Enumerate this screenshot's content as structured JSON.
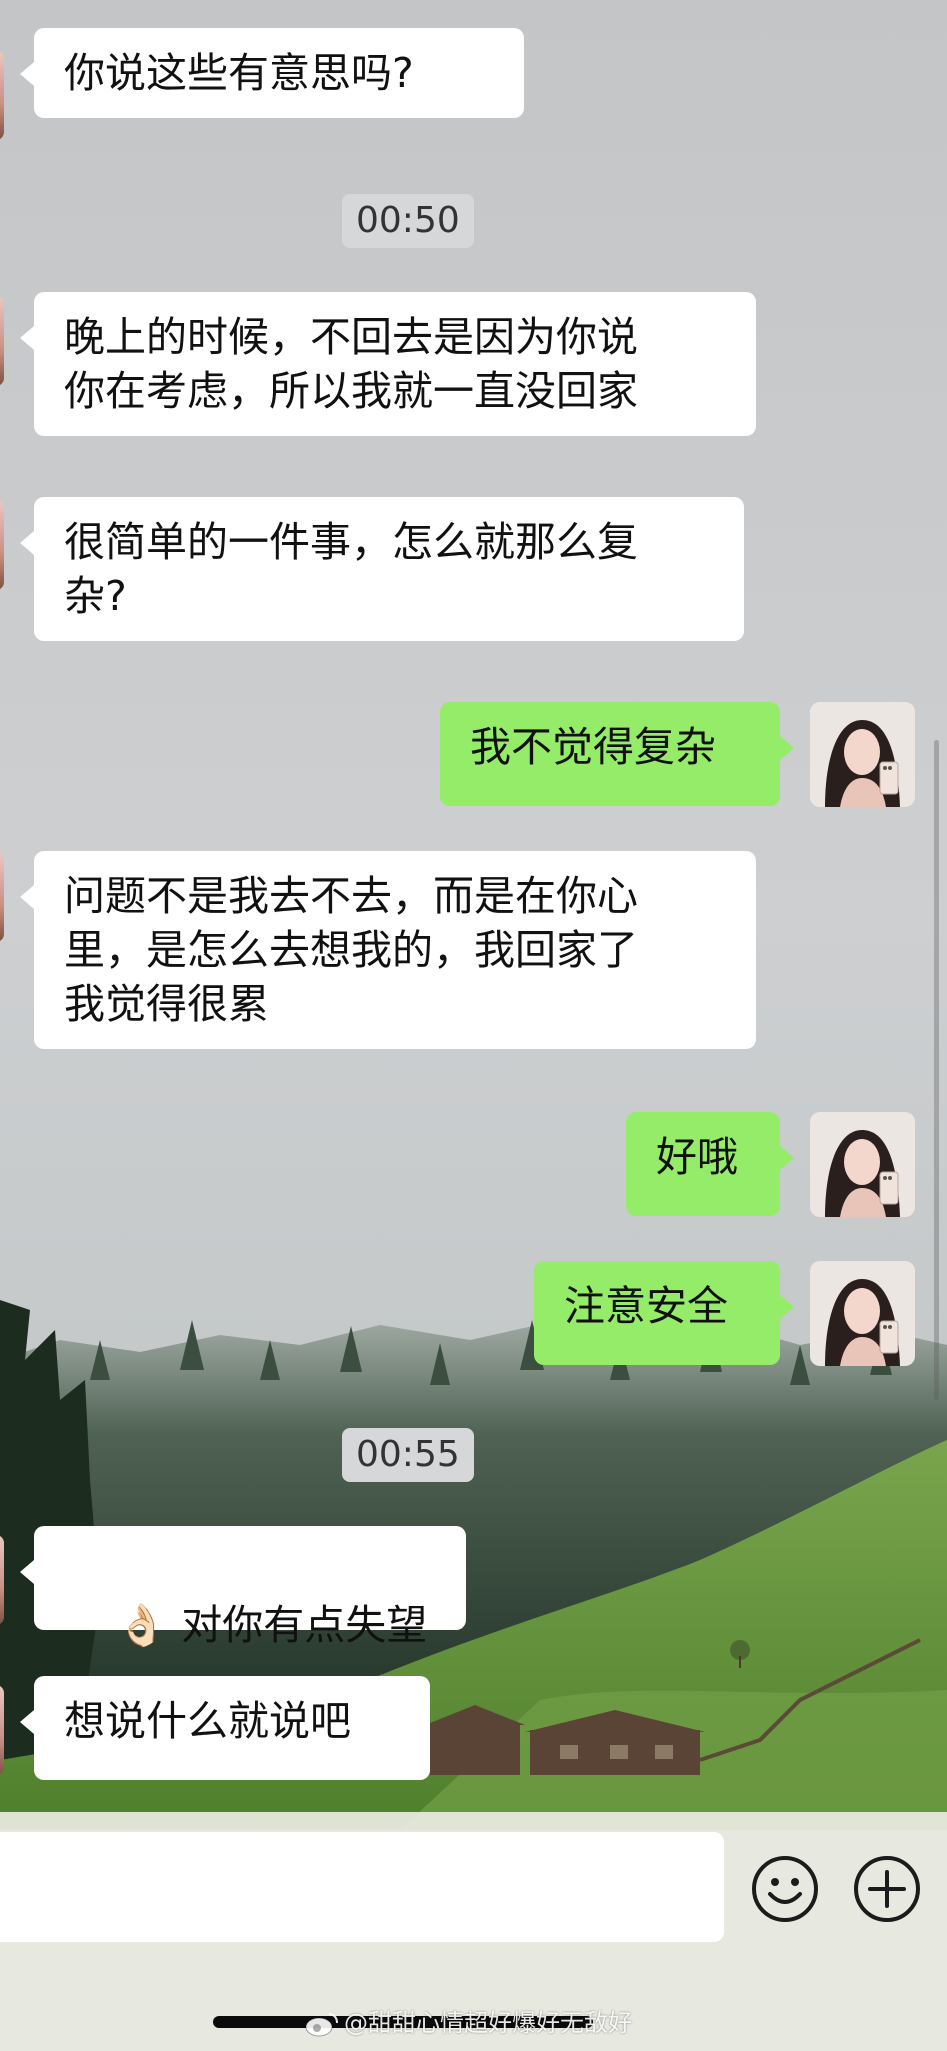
{
  "chat": {
    "messages": [
      {
        "id": "m1",
        "side": "in",
        "text": "你说这些有意思吗?"
      },
      {
        "id": "t1",
        "type": "time",
        "text": "00:50"
      },
      {
        "id": "m2",
        "side": "in",
        "text": "晚上的时候，不回去是因为你说\n你在考虑，所以我就一直没回家"
      },
      {
        "id": "m3",
        "side": "in",
        "text": "很简单的一件事，怎么就那么复\n杂?"
      },
      {
        "id": "m4",
        "side": "out",
        "text": "我不觉得复杂"
      },
      {
        "id": "m5",
        "side": "in",
        "text": "问题不是我去不去，而是在你心\n里，是怎么去想我的，我回家了\n我觉得很累"
      },
      {
        "id": "m6",
        "side": "out",
        "text": "好哦"
      },
      {
        "id": "m7",
        "side": "out",
        "text": "注意安全"
      },
      {
        "id": "t2",
        "type": "time",
        "text": "00:55"
      },
      {
        "id": "m8",
        "side": "in",
        "emoji": "👌🏻",
        "text": "对你有点失望"
      },
      {
        "id": "m9",
        "side": "in",
        "text": "想说什么就说吧"
      }
    ]
  },
  "input_bar": {
    "emoji_icon": "smiley-face-icon",
    "add_icon": "plus-circle-icon"
  },
  "watermark": {
    "text": "@甜甜心情超好爆好无敌好",
    "logo_icon": "weibo-logo-icon"
  },
  "colors": {
    "incoming_bubble": "#ffffff",
    "outgoing_bubble": "#95ec69",
    "timestamp_bg": "#d6d7d8"
  }
}
